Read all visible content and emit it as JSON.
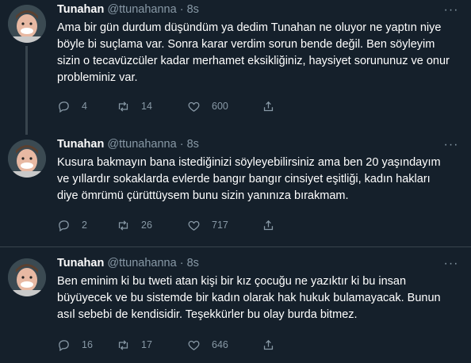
{
  "tweets": [
    {
      "name": "Tunahan",
      "handle": "@ttunahanna",
      "separator": "·",
      "time": "8s",
      "text": "Ama bir gün durdum düşündüm ya dedim Tunahan ne oluyor ne yaptın niye\nböyle bi suçlama var. Sonra karar verdim sorun bende değil. Ben söyleyim\nsizin o tecavüzcüler kadar merhamet eksikliğiniz, haysiyet sorununuz ve onur\nprobleminiz var.",
      "replies": "4",
      "retweets": "14",
      "likes": "600"
    },
    {
      "name": "Tunahan",
      "handle": "@ttunahanna",
      "separator": "·",
      "time": "8s",
      "text": "Kusura bakmayın bana istediğinizi söyleyebilirsiniz ama ben 20 yaşındayım\nve yıllardır sokaklarda evlerde bangır bangır cinsiyet eşitliği, kadın hakları\ndiye ömrümü çürüttüysem bunu sizin yanınıza bırakmam.",
      "replies": "2",
      "retweets": "26",
      "likes": "717"
    },
    {
      "name": "Tunahan",
      "handle": "@ttunahanna",
      "separator": "·",
      "time": "8s",
      "text": "Ben eminim ki bu tweti atan kişi bir kız çocuğu ne yazıktır ki bu insan\nbüyüyecek ve bu sistemde bir kadın olarak hak hukuk bulamayacak. Bunun\nasıl sebebi de kendisidir. Teşekkürler bu olay burda bitmez.",
      "replies": "16",
      "retweets": "17",
      "likes": "646"
    }
  ],
  "colors": {
    "background": "#15202b",
    "text": "#ffffff",
    "secondary": "#8899a6",
    "divider": "#38444d"
  },
  "icons": {
    "reply": "reply-icon",
    "retweet": "retweet-icon",
    "like": "heart-icon",
    "share": "share-icon",
    "more": "more-icon"
  }
}
